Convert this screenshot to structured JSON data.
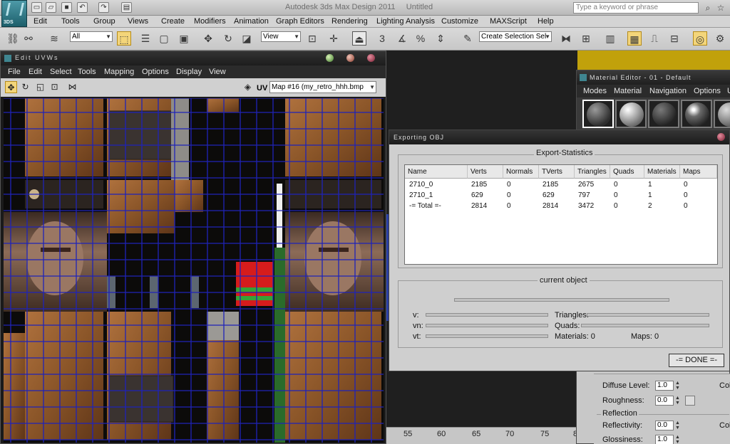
{
  "app": {
    "title": "Autodesk 3ds Max Design 2011",
    "file_title": "Untitled",
    "logo_text": "3DS"
  },
  "search": {
    "placeholder": "Type a keyword or phrase"
  },
  "menubar": [
    "Edit",
    "Tools",
    "Group",
    "Views",
    "Create",
    "Modifiers",
    "Animation",
    "Graph Editors",
    "Rendering",
    "Lighting Analysis",
    "Customize",
    "MAXScript",
    "Help"
  ],
  "toolbar": {
    "filter_value": "All",
    "view_value": "View",
    "selection_set_value": "Create Selection Sel",
    "spinner_labels": [
      "3",
      "n",
      "%",
      "n"
    ]
  },
  "uvw": {
    "title": "Edit UVWs",
    "menu": [
      "File",
      "Edit",
      "Select",
      "Tools",
      "Mapping",
      "Options",
      "Display",
      "View"
    ],
    "uv_label": "UV",
    "map_value": "Map #16 (my_retro_hhh.bmp"
  },
  "ruler": [
    "55",
    "60",
    "65",
    "70",
    "75",
    "8"
  ],
  "material_editor": {
    "title": "Material Editor - 01 - Default",
    "menu": [
      "Modes",
      "Material",
      "Navigation",
      "Options",
      "U"
    ],
    "diffuse_level_label": "Diffuse Level:",
    "diffuse_level_value": "1.0",
    "roughness_label": "Roughness:",
    "roughness_value": "0.0",
    "reflection_group": "Reflection",
    "reflectivity_label": "Reflectivity:",
    "reflectivity_value": "0.0",
    "glossiness_label": "Glossiness:",
    "glossiness_value": "1.0",
    "color_label_1": "Colo",
    "color_label_2": "Colo"
  },
  "export_dialog": {
    "title": "Exporting OBJ",
    "stats_group": "Export-Statistics",
    "columns": [
      "Name",
      "Verts",
      "Normals",
      "TVerts",
      "Triangles",
      "Quads",
      "Materials",
      "Maps"
    ],
    "rows": [
      [
        "2710_0",
        "2185",
        "0",
        "2185",
        "2675",
        "0",
        "1",
        "0"
      ],
      [
        "2710_1",
        "629",
        "0",
        "629",
        "797",
        "0",
        "1",
        "0"
      ],
      [
        "-= Total =-",
        "2814",
        "0",
        "2814",
        "3472",
        "0",
        "2",
        "0"
      ]
    ],
    "current_group": "current object",
    "v_label": "v:",
    "vn_label": "vn:",
    "vt_label": "vt:",
    "triangles_label": "Triangles:",
    "quads_label": "Quads:",
    "materials_text": "Materials: 0",
    "maps_text": "Maps: 0",
    "done_label": "-= DONE =-"
  },
  "colors": {
    "accent_active": "#f3d57a",
    "viewport_yellow": "#c1a10b",
    "grid_blue": "#1f23b8"
  }
}
